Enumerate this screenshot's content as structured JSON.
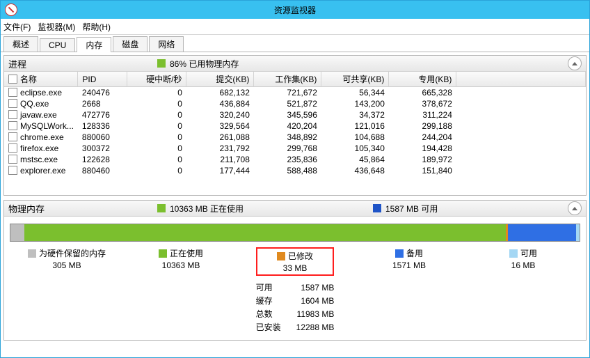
{
  "title": "资源监视器",
  "menus": {
    "file": "文件(F)",
    "monitor": "监视器(M)",
    "help": "帮助(H)"
  },
  "tabs": {
    "overview": "概述",
    "cpu": "CPU",
    "memory": "内存",
    "disk": "磁盘",
    "network": "网络"
  },
  "proc_panel": {
    "title": "进程",
    "pct_text": "86% 已用物理内存",
    "swatch": "#7bbf2e",
    "cols": {
      "name": "名称",
      "pid": "PID",
      "hard": "硬中断/秒",
      "commit": "提交(KB)",
      "working": "工作集(KB)",
      "share": "可共享(KB)",
      "private": "专用(KB)"
    },
    "rows": [
      {
        "name": "eclipse.exe",
        "pid": "240476",
        "hard": "0",
        "commit": "682,132",
        "working": "721,672",
        "share": "56,344",
        "private": "665,328"
      },
      {
        "name": "QQ.exe",
        "pid": "2668",
        "hard": "0",
        "commit": "436,884",
        "working": "521,872",
        "share": "143,200",
        "private": "378,672"
      },
      {
        "name": "javaw.exe",
        "pid": "472776",
        "hard": "0",
        "commit": "320,240",
        "working": "345,596",
        "share": "34,372",
        "private": "311,224"
      },
      {
        "name": "MySQLWork...",
        "pid": "128336",
        "hard": "0",
        "commit": "329,564",
        "working": "420,204",
        "share": "121,016",
        "private": "299,188"
      },
      {
        "name": "chrome.exe",
        "pid": "880060",
        "hard": "0",
        "commit": "261,088",
        "working": "348,892",
        "share": "104,688",
        "private": "244,204"
      },
      {
        "name": "firefox.exe",
        "pid": "300372",
        "hard": "0",
        "commit": "231,792",
        "working": "299,768",
        "share": "105,340",
        "private": "194,428"
      },
      {
        "name": "mstsc.exe",
        "pid": "122628",
        "hard": "0",
        "commit": "211,708",
        "working": "235,836",
        "share": "45,864",
        "private": "189,972"
      },
      {
        "name": "explorer.exe",
        "pid": "880460",
        "hard": "0",
        "commit": "177,444",
        "working": "588,488",
        "share": "436,648",
        "private": "151,840"
      }
    ]
  },
  "mem_panel": {
    "title": "物理内存",
    "used_text": "10363 MB 正在使用",
    "used_color": "#7bbf2e",
    "avail_text": "1587 MB 可用",
    "avail_color": "#1f54c7",
    "bar": {
      "reserved": {
        "color": "#bfbfbf",
        "pct": 2.5
      },
      "inuse": {
        "color": "#7bbf2e",
        "pct": 84.5
      },
      "modified": {
        "color": "#e08a1f",
        "pct": 0.4
      },
      "standby": {
        "color": "#2f6fe4",
        "pct": 12.0
      },
      "free": {
        "color": "#a4d7f4",
        "pct": 0.6
      }
    },
    "legend": {
      "reserved": {
        "label": "为硬件保留的内存",
        "value": "305 MB",
        "swatch": "#bfbfbf"
      },
      "inuse": {
        "label": "正在使用",
        "value": "10363 MB",
        "swatch": "#7bbf2e"
      },
      "modified": {
        "label": "已修改",
        "value": "33 MB",
        "swatch": "#e08a1f"
      },
      "standby": {
        "label": "备用",
        "value": "1571 MB",
        "swatch": "#2f6fe4"
      },
      "free": {
        "label": "可用",
        "value": "16 MB",
        "swatch": "#a4d7f4"
      }
    },
    "stats": {
      "avail": {
        "label": "可用",
        "value": "1587 MB"
      },
      "cache": {
        "label": "缓存",
        "value": "1604 MB"
      },
      "total": {
        "label": "总数",
        "value": "11983 MB"
      },
      "install": {
        "label": "已安装",
        "value": "12288 MB"
      }
    }
  }
}
